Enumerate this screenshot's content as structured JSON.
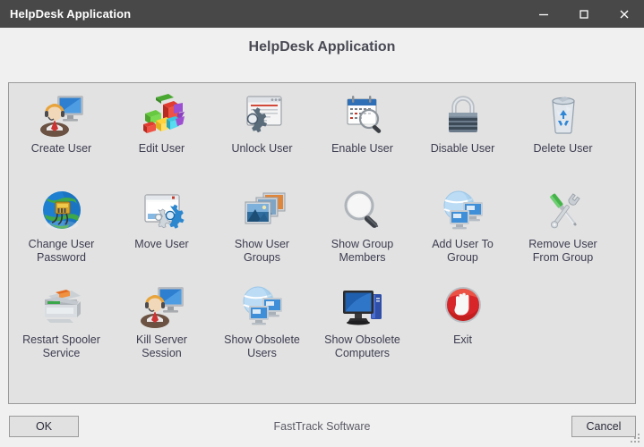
{
  "window": {
    "title": "HelpDesk Application",
    "titlebar_bg": "#484848",
    "controls": {
      "minimize": "minimize",
      "maximize": "maximize",
      "close": "close"
    }
  },
  "header": {
    "title": "HelpDesk Application"
  },
  "panel": {
    "items": [
      {
        "label": "Create User",
        "icon": "user-monitor-icon"
      },
      {
        "label": "Edit User",
        "icon": "colored-blocks-icon"
      },
      {
        "label": "Unlock User",
        "icon": "window-gear-icon"
      },
      {
        "label": "Enable User",
        "icon": "calendar-magnifier-icon"
      },
      {
        "label": "Disable User",
        "icon": "padlock-icon"
      },
      {
        "label": "Delete User",
        "icon": "recycle-bin-icon"
      },
      {
        "label": "Change User\nPassword",
        "icon": "globe-network-plug-icon"
      },
      {
        "label": "Move User",
        "icon": "window-gears-icon"
      },
      {
        "label": "Show User\nGroups",
        "icon": "stacked-photos-icon"
      },
      {
        "label": "Show Group\nMembers",
        "icon": "magnifier-icon"
      },
      {
        "label": "Add User To\nGroup",
        "icon": "globe-monitors-icon"
      },
      {
        "label": "Remove User\nFrom Group",
        "icon": "screwdriver-wrench-icon"
      },
      {
        "label": "Restart Spooler\nService",
        "icon": "printer-icon"
      },
      {
        "label": "Kill Server\nSession",
        "icon": "user-monitor-icon"
      },
      {
        "label": "Show Obsolete\nUsers",
        "icon": "globe-monitors-icon"
      },
      {
        "label": "Show Obsolete\nComputers",
        "icon": "desktop-computer-icon"
      },
      {
        "label": "Exit",
        "icon": "stop-hand-icon"
      }
    ]
  },
  "footer": {
    "ok_label": "OK",
    "cancel_label": "Cancel",
    "branding": "FastTrack Software"
  },
  "colors": {
    "titlebar": "#484848",
    "page_bg": "#f0f0f0",
    "panel_bg": "#e2e2e2",
    "panel_border": "#9a9a9a",
    "label_text": "#3c3c50",
    "header_text": "#4a4a55",
    "exit_red": "#d02a18"
  }
}
